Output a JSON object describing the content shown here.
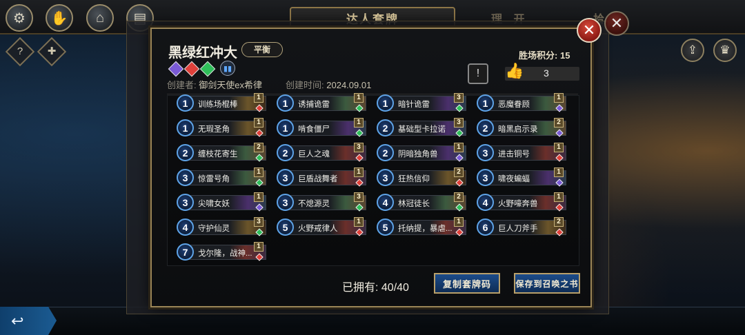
{
  "top_tabs": {
    "active": "达人套牌",
    "inactive_1": "理 开",
    "inactive_2": "拾"
  },
  "deck": {
    "name": "黑绿红冲大",
    "style_badge": "平衡",
    "creator_label": "创建者:",
    "creator": "御剑天使ex希律",
    "created_label": "创建时间:",
    "created": "2024.09.01",
    "score_label": "胜场积分:",
    "score": "15",
    "likes": "3",
    "owned_label": "已拥有:",
    "owned": "40/40"
  },
  "buttons": {
    "copy": "复制套牌码",
    "save": "保存到召唤之书"
  },
  "colors": {
    "region_colors": [
      "#7a5ad6",
      "#e0403a",
      "#2fbf5a"
    ],
    "accent_gold": "#9b8556",
    "cost_blue": "#5fa4e8"
  },
  "cards": [
    {
      "cost": "1",
      "name": "训练场棍棒",
      "count": "1",
      "region": "red",
      "tone": "gold"
    },
    {
      "cost": "1",
      "name": "诱捕诡雷",
      "count": "1",
      "region": "green",
      "tone": "green"
    },
    {
      "cost": "1",
      "name": "暗针诡雷",
      "count": "3",
      "region": "green",
      "tone": "purple"
    },
    {
      "cost": "1",
      "name": "恶魔眷顾",
      "count": "1",
      "region": "purple",
      "tone": "green"
    },
    {
      "cost": "1",
      "name": "无瑕圣角",
      "count": "1",
      "region": "red",
      "tone": "gold"
    },
    {
      "cost": "1",
      "name": "啃食僵尸",
      "count": "1",
      "region": "green",
      "tone": "purple"
    },
    {
      "cost": "2",
      "name": "基础型卡拉诺",
      "count": "3",
      "region": "green",
      "tone": "purple"
    },
    {
      "cost": "2",
      "name": "暗黑启示录",
      "count": "2",
      "region": "purple",
      "tone": "green"
    },
    {
      "cost": "2",
      "name": "缠枝花寄生",
      "count": "2",
      "region": "green",
      "tone": "green"
    },
    {
      "cost": "2",
      "name": "巨人之魂",
      "count": "3",
      "region": "red",
      "tone": "red"
    },
    {
      "cost": "2",
      "name": "阴暗独角兽",
      "count": "1",
      "region": "purple",
      "tone": "purple"
    },
    {
      "cost": "3",
      "name": "进击铜号",
      "count": "1",
      "region": "red",
      "tone": "red"
    },
    {
      "cost": "3",
      "name": "惊雷号角",
      "count": "1",
      "region": "green",
      "tone": "green"
    },
    {
      "cost": "3",
      "name": "巨盾战舞者",
      "count": "1",
      "region": "red",
      "tone": "red"
    },
    {
      "cost": "3",
      "name": "狂热信仰",
      "count": "2",
      "region": "red",
      "tone": "gold"
    },
    {
      "cost": "3",
      "name": "啸夜蝙蝠",
      "count": "1",
      "region": "purple",
      "tone": "purple"
    },
    {
      "cost": "3",
      "name": "尖啸女妖",
      "count": "1",
      "region": "purple",
      "tone": "purple"
    },
    {
      "cost": "3",
      "name": "不熄源灵",
      "count": "3",
      "region": "green",
      "tone": "green"
    },
    {
      "cost": "4",
      "name": "林冠徒长",
      "count": "2",
      "region": "green",
      "tone": "green"
    },
    {
      "cost": "4",
      "name": "火野嚎奔兽",
      "count": "1",
      "region": "red",
      "tone": "red"
    },
    {
      "cost": "4",
      "name": "守护仙灵",
      "count": "3",
      "region": "green",
      "tone": "gold"
    },
    {
      "cost": "5",
      "name": "火野戒律人",
      "count": "1",
      "region": "red",
      "tone": "red"
    },
    {
      "cost": "5",
      "name": "托纳提，暴虐...",
      "count": "1",
      "region": "red",
      "tone": "red"
    },
    {
      "cost": "6",
      "name": "巨人刀斧手",
      "count": "2",
      "region": "red",
      "tone": "gold"
    },
    {
      "cost": "7",
      "name": "戈尔隆，战神...",
      "count": "1",
      "region": "red",
      "tone": "red"
    }
  ]
}
